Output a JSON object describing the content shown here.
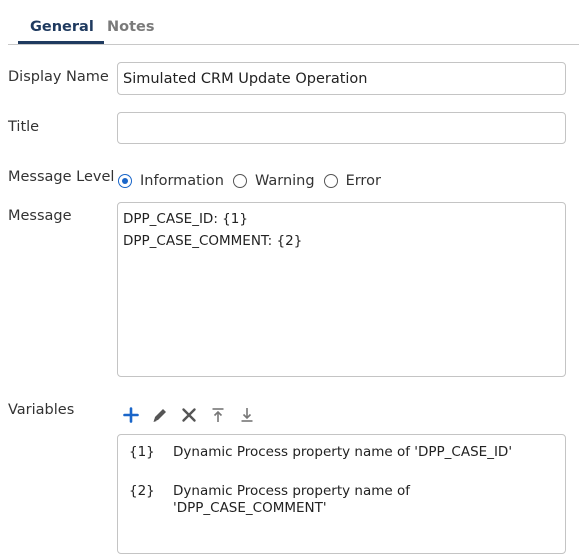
{
  "tabs": [
    {
      "label": "General",
      "active": true
    },
    {
      "label": "Notes",
      "active": false
    }
  ],
  "form": {
    "display_name_label": "Display Name",
    "display_name_value": "Simulated CRM Update Operation",
    "title_label": "Title",
    "title_value": "",
    "message_level_label": "Message Level",
    "message_levels": [
      {
        "label": "Information",
        "checked": true
      },
      {
        "label": "Warning",
        "checked": false
      },
      {
        "label": "Error",
        "checked": false
      }
    ],
    "message_label": "Message",
    "message_value": "DPP_CASE_ID: {1}\nDPP_CASE_COMMENT: {2}",
    "variables_label": "Variables"
  },
  "toolbar": {
    "icons": [
      "plus-icon",
      "pencil-icon",
      "x-icon",
      "move-top-icon",
      "move-bottom-icon"
    ],
    "accent_color": "#1a66c9"
  },
  "variables": [
    {
      "key": "{1}",
      "description": "Dynamic Process property name of 'DPP_CASE_ID'"
    },
    {
      "key": "{2}",
      "description": "Dynamic Process property name of 'DPP_CASE_COMMENT'"
    }
  ],
  "colors": {
    "tab_active": "#1f3a5f",
    "tab_inactive": "#7a7a7a",
    "border": "#c4c4c4",
    "radio_checked": "#1a66c9"
  }
}
